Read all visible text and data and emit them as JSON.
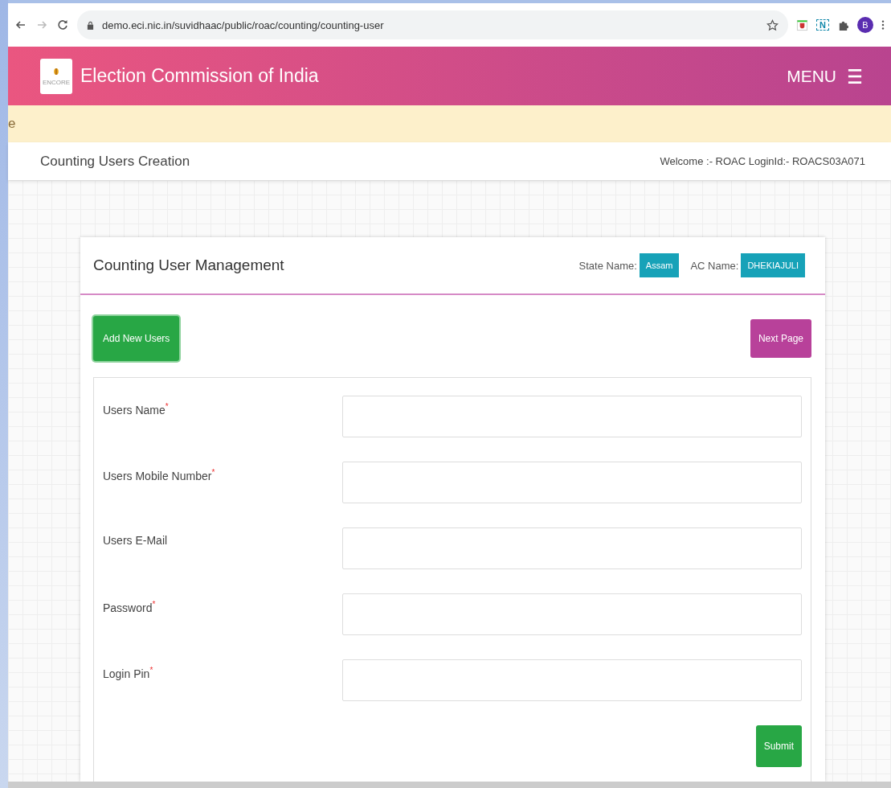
{
  "browser": {
    "url": "demo.eci.nic.in/suvidhaac/public/roac/counting/counting-user",
    "profile_initial": "B",
    "extension_letter": "N"
  },
  "header": {
    "logo_text": "ENCORE",
    "title": "Election Commission of India",
    "menu_label": "MENU"
  },
  "notice": {
    "text": "e"
  },
  "subheader": {
    "title": "Counting Users Creation",
    "welcome": "Welcome :- ROAC LoginId:- ROACS03A071"
  },
  "card": {
    "title": "Counting User Management",
    "state_label": "State Name:",
    "state_value": "Assam",
    "ac_label": "AC Name:",
    "ac_value": "DHEKIAJULI",
    "add_button": "Add New Users",
    "next_button": "Next Page",
    "fields": [
      {
        "label": "Users Name",
        "required_mark": "*"
      },
      {
        "label": "Users Mobile Number",
        "required_mark": "*"
      },
      {
        "label": "Users E-Mail"
      },
      {
        "label": "Password",
        "required_mark": "*"
      },
      {
        "label": "Login Pin",
        "required_mark": "*"
      }
    ],
    "submit_button": "Submit"
  }
}
